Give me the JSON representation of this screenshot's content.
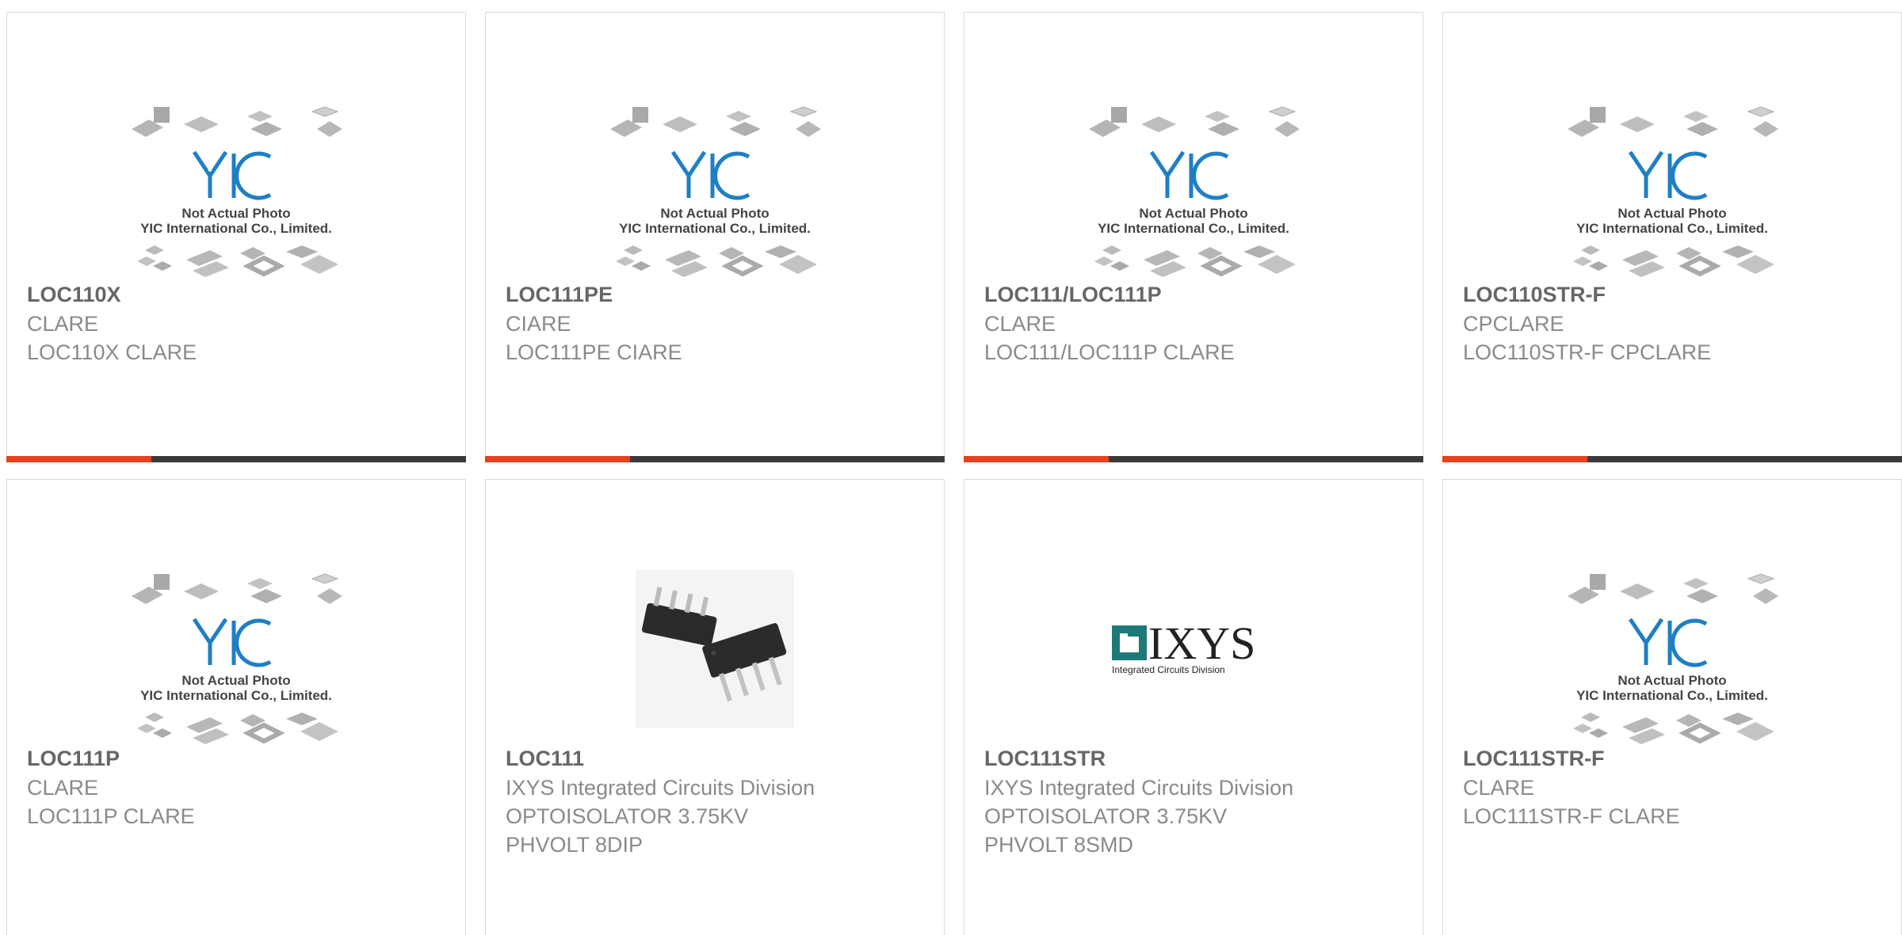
{
  "products": [
    {
      "part": "LOC110X",
      "maker": "CLARE",
      "desc": "LOC110X CLARE",
      "desc2": "",
      "image": "placeholder",
      "placeholder_text1": "Not Actual Photo",
      "placeholder_text2": "YIC International Co., Limited."
    },
    {
      "part": "LOC111PE",
      "maker": "CIARE",
      "desc": "LOC111PE CIARE",
      "desc2": "",
      "image": "placeholder",
      "placeholder_text1": "Not Actual Photo",
      "placeholder_text2": "YIC International Co., Limited."
    },
    {
      "part": "LOC111/LOC111P",
      "maker": "CLARE",
      "desc": "LOC111/LOC111P CLARE",
      "desc2": "",
      "image": "placeholder",
      "placeholder_text1": "Not Actual Photo",
      "placeholder_text2": "YIC International Co., Limited."
    },
    {
      "part": "LOC110STR-F",
      "maker": "CPCLARE",
      "desc": "LOC110STR-F CPCLARE",
      "desc2": "",
      "image": "placeholder",
      "placeholder_text1": "Not Actual Photo",
      "placeholder_text2": "YIC International Co., Limited."
    },
    {
      "part": "LOC111P",
      "maker": "CLARE",
      "desc": "LOC111P CLARE",
      "desc2": "",
      "image": "placeholder",
      "placeholder_text1": "Not Actual Photo",
      "placeholder_text2": "YIC International Co., Limited."
    },
    {
      "part": "LOC111",
      "maker": "IXYS Integrated Circuits Division",
      "desc": "OPTOISOLATOR 3.75KV",
      "desc2": "PHVOLT 8DIP",
      "image": "dip-chip-photo"
    },
    {
      "part": "LOC111STR",
      "maker": "IXYS Integrated Circuits Division",
      "desc": "OPTOISOLATOR 3.75KV",
      "desc2": "PHVOLT 8SMD",
      "image": "ixys-logo",
      "logo_text": "IXYS",
      "logo_sub": "Integrated Circuits Division"
    },
    {
      "part": "LOC111STR-F",
      "maker": "CLARE",
      "desc": "LOC111STR-F CLARE",
      "desc2": "",
      "image": "placeholder",
      "placeholder_text1": "Not Actual Photo",
      "placeholder_text2": "YIC International Co., Limited."
    }
  ],
  "colors": {
    "accent": "#e8401c",
    "bar": "#3b3b3b",
    "yic_blue": "#1f7fc4"
  }
}
